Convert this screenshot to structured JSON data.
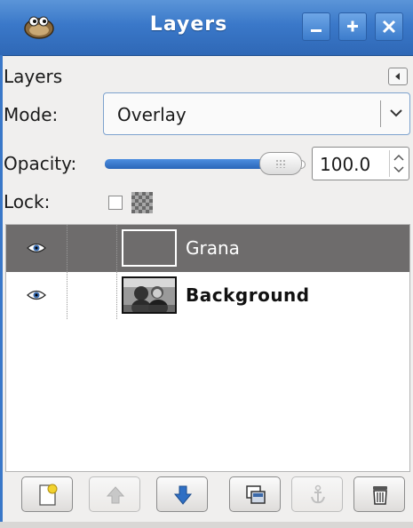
{
  "window": {
    "title": "Layers",
    "icon": "gimp-wilber-icon",
    "buttons": [
      "minimize-icon",
      "maximize-icon",
      "close-icon"
    ]
  },
  "dock": {
    "tab_label": "Layers",
    "tab_menu_icon": "tab-menu-arrow-icon"
  },
  "mode": {
    "label": "Mode:",
    "value": "Overlay"
  },
  "opacity": {
    "label": "Opacity:",
    "value": "100.0",
    "level_percent": 100
  },
  "lock": {
    "label": "Lock:",
    "checked": false,
    "icon": "lock-alpha-checker-icon"
  },
  "layers": [
    {
      "name": "Grana",
      "visible": true,
      "selected": true
    },
    {
      "name": "Background",
      "visible": true,
      "selected": false
    }
  ],
  "toolbar": [
    {
      "icon": "new-layer-icon",
      "enabled": true
    },
    {
      "icon": "raise-layer-icon",
      "enabled": false
    },
    {
      "icon": "lower-layer-icon",
      "enabled": true
    },
    {
      "icon": "duplicate-layer-icon",
      "enabled": true
    },
    {
      "icon": "anchor-layer-icon",
      "enabled": false
    },
    {
      "icon": "delete-layer-icon",
      "enabled": true
    }
  ],
  "colors": {
    "titlebar": "#3a78c9",
    "selected_row": "#6e6c6c",
    "slider_fill": "#2a66b8"
  }
}
